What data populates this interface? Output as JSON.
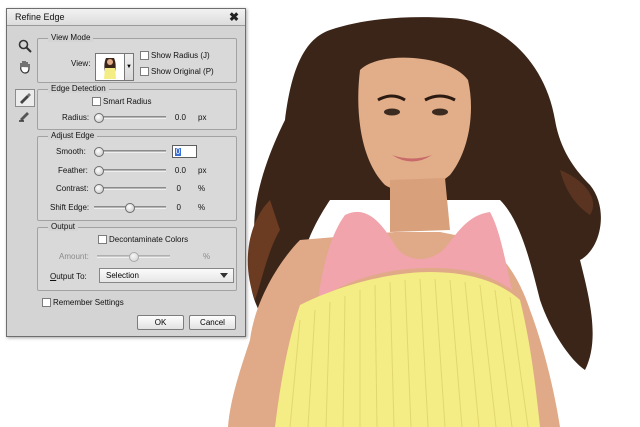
{
  "dialog": {
    "title": "Refine Edge",
    "close_glyph": "✖",
    "tools": [
      "zoom-icon",
      "hand-icon",
      "refine-radius-brush-icon",
      "erase-refinements-brush-icon"
    ],
    "view_mode": {
      "legend": "View Mode",
      "view_label": "View:",
      "show_radius": "Show Radius (J)",
      "show_original": "Show Original (P)",
      "show_radius_checked": false,
      "show_original_checked": false
    },
    "edge_detection": {
      "legend": "Edge Detection",
      "smart_radius": "Smart Radius",
      "smart_radius_checked": false,
      "radius_label": "Radius:",
      "radius_value": "0.0",
      "radius_unit": "px",
      "radius_level": 0
    },
    "adjust_edge": {
      "legend": "Adjust Edge",
      "smooth_label": "Smooth:",
      "smooth_value": "0",
      "smooth_level": 0,
      "feather_label": "Feather:",
      "feather_value": "0.0",
      "feather_unit": "px",
      "feather_level": 0,
      "contrast_label": "Contrast:",
      "contrast_value": "0",
      "contrast_unit": "%",
      "contrast_level": 0,
      "shift_label": "Shift Edge:",
      "shift_value": "0",
      "shift_unit": "%",
      "shift_level": 0.5
    },
    "output": {
      "legend": "Output",
      "decontaminate": "Decontaminate Colors",
      "decontaminate_checked": false,
      "amount_label": "Amount:",
      "amount_unit": "%",
      "amount_level": 0.5,
      "output_to_label": "Output To:",
      "output_to_value": "Selection"
    },
    "remember_settings": "Remember Settings",
    "remember_checked": false,
    "ok_label": "OK",
    "cancel_label": "Cancel"
  },
  "colors": {
    "dialog_bg": "#d4d4d4",
    "selection_blue": "#3a6fd8",
    "hair": "#3a2418",
    "skin": "#e5b28f",
    "halter_pink": "#f1a6ad",
    "dress_yellow": "#f3ec86"
  }
}
